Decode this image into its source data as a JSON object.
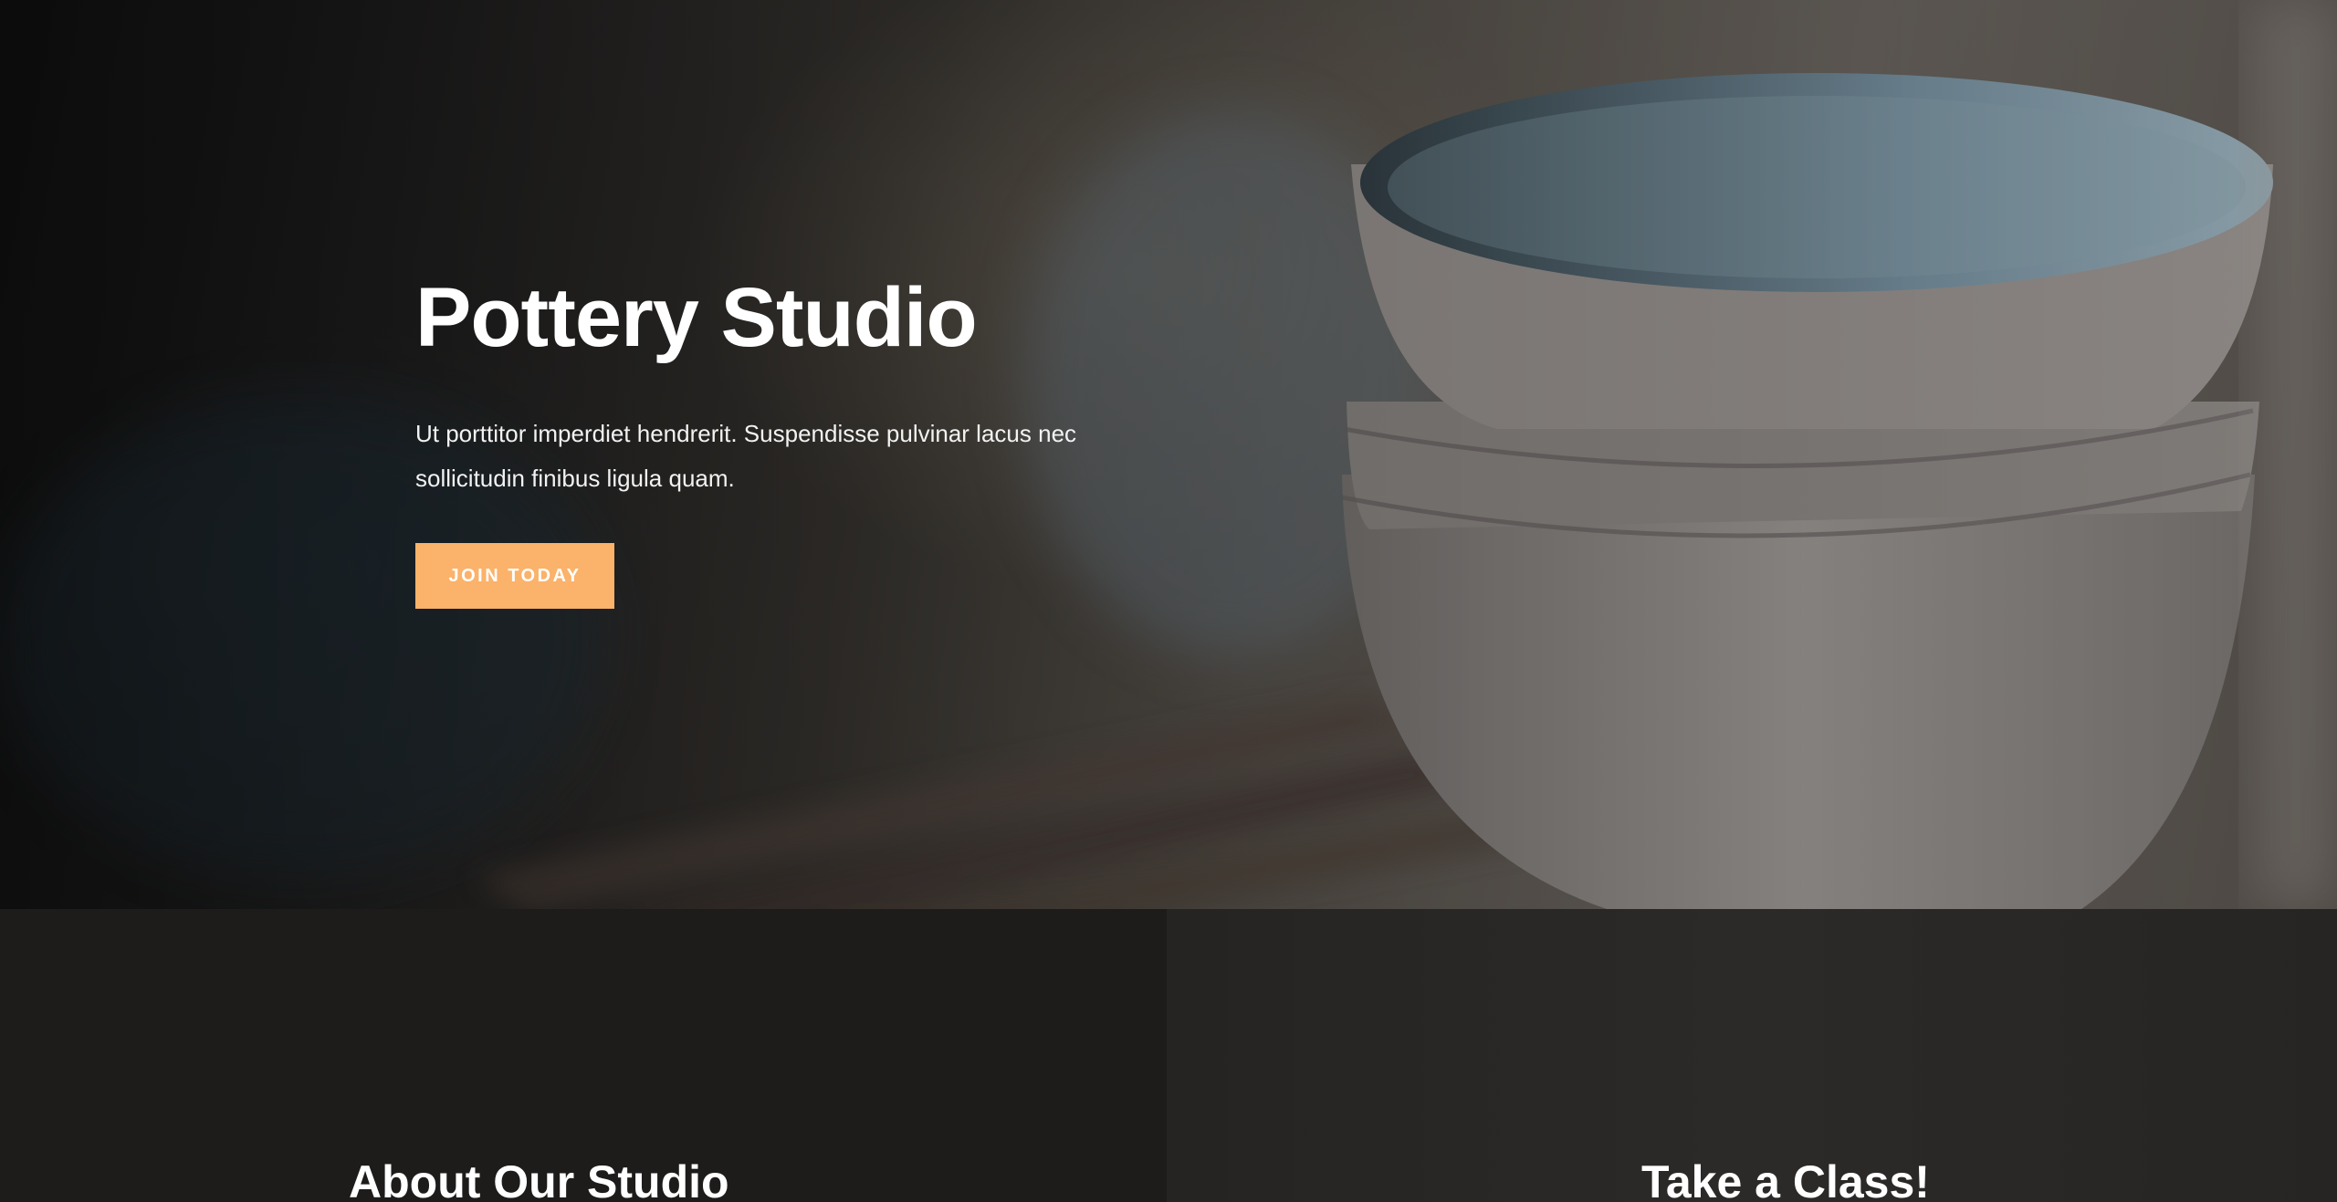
{
  "hero": {
    "title": "Pottery Studio",
    "description": "Ut porttitor imperdiet hendrerit. Suspendisse pulvinar lacus nec sollicitudin finibus ligula quam.",
    "cta_label": "JOIN TODAY",
    "background_image": "stacked-ceramic-bowls-photo"
  },
  "sections": {
    "about_heading": "About Our Studio",
    "class_heading": "Take a Class!"
  },
  "colors": {
    "accent": "#fbb26a",
    "dark_panel": "#1d1c1b",
    "text": "#ffffff"
  }
}
